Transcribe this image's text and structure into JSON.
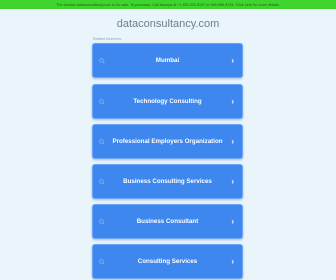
{
  "banner": {
    "text": "The domain dataconsultancy.com is for sale. To purchase, Call Kaseya at +1 833 322 8107 or 949-569-8754. Click here for more details."
  },
  "domain": "dataconsultancy.com",
  "related_label": "Related Searches:",
  "links": [
    {
      "label": "Mumbai"
    },
    {
      "label": "Technology Consulting"
    },
    {
      "label": "Professional Employers Organization"
    },
    {
      "label": "Business Consulting Services"
    },
    {
      "label": "Business Consultant"
    },
    {
      "label": "Consulting Services"
    }
  ],
  "icons": {
    "search": "search-icon",
    "chevron": "chevron-right-icon"
  },
  "colors": {
    "banner": "#3fd42e",
    "button": "#3d87ee",
    "background": "#eaf4fb"
  }
}
